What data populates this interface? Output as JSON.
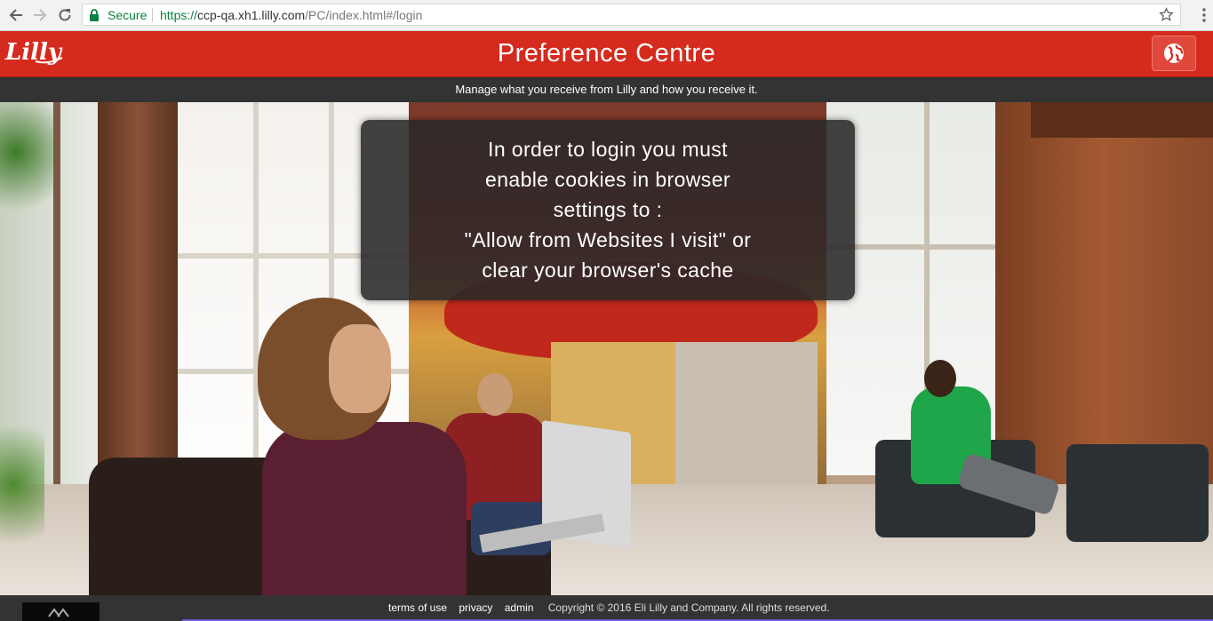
{
  "browser": {
    "secure_label": "Secure",
    "url_scheme": "https://",
    "url_host": "ccp-qa.xh1.lilly.com",
    "url_path": "/PC/index.html#/login"
  },
  "header": {
    "title": "Preference Centre",
    "logo_text": "Lilly",
    "brand_color": "#d52b1e"
  },
  "subbar": {
    "tagline": "Manage what you receive from Lilly and how you receive it."
  },
  "message": {
    "lines": [
      "In order to login you must",
      "enable cookies in browser",
      "settings to :",
      "\"Allow from Websites I visit\" or",
      "clear your browser's cache"
    ]
  },
  "footer": {
    "terms": "terms of use",
    "privacy": "privacy",
    "admin": "admin",
    "copyright": "Copyright © 2016 Eli Lilly and Company. All rights reserved."
  },
  "icons": [
    "back-arrow-icon",
    "forward-arrow-icon",
    "reload-icon",
    "lock-icon",
    "star-icon",
    "menu-dots-icon",
    "globe-icon"
  ]
}
